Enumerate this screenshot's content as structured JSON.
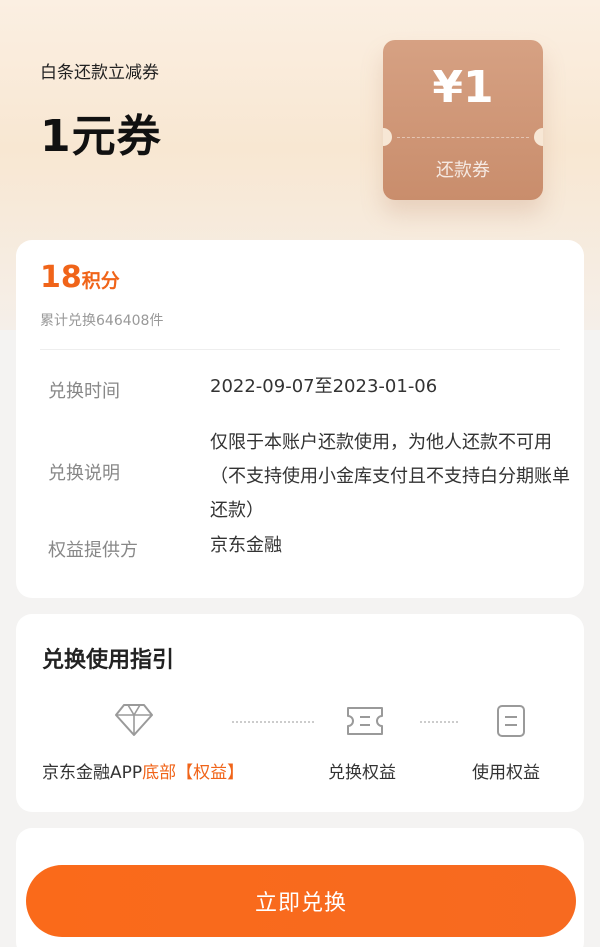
{
  "hero": {
    "subtitle": "白条还款立减券",
    "title": "1元券",
    "ticket_amount": "¥1",
    "ticket_label": "还款券"
  },
  "detail": {
    "points_value": "18",
    "points_unit": "积分",
    "redeemed_text": "累计兑换646408件",
    "rows": [
      {
        "key": "兑换时间",
        "value": "2022-09-07至2023-01-06"
      },
      {
        "key": "兑换说明",
        "value": "仅限于本账户还款使用，为他人还款不可用（不支持使用小金库支付且不支持白分期账单还款）"
      },
      {
        "key": "权益提供方",
        "value": "京东金融"
      }
    ]
  },
  "guide": {
    "title": "兑换使用指引",
    "steps": [
      {
        "label_main": "京东金融APP",
        "label_accent": "底部【权益】",
        "icon": "diamond-icon"
      },
      {
        "label_main": "兑换权益",
        "icon": "ticket-icon"
      },
      {
        "label_main": "使用权益",
        "icon": "document-icon"
      }
    ]
  },
  "cta": {
    "label": "立即兑换"
  },
  "colors": {
    "accent": "#f06419",
    "ticket": "#cc9272",
    "button": "#f86a1d"
  }
}
